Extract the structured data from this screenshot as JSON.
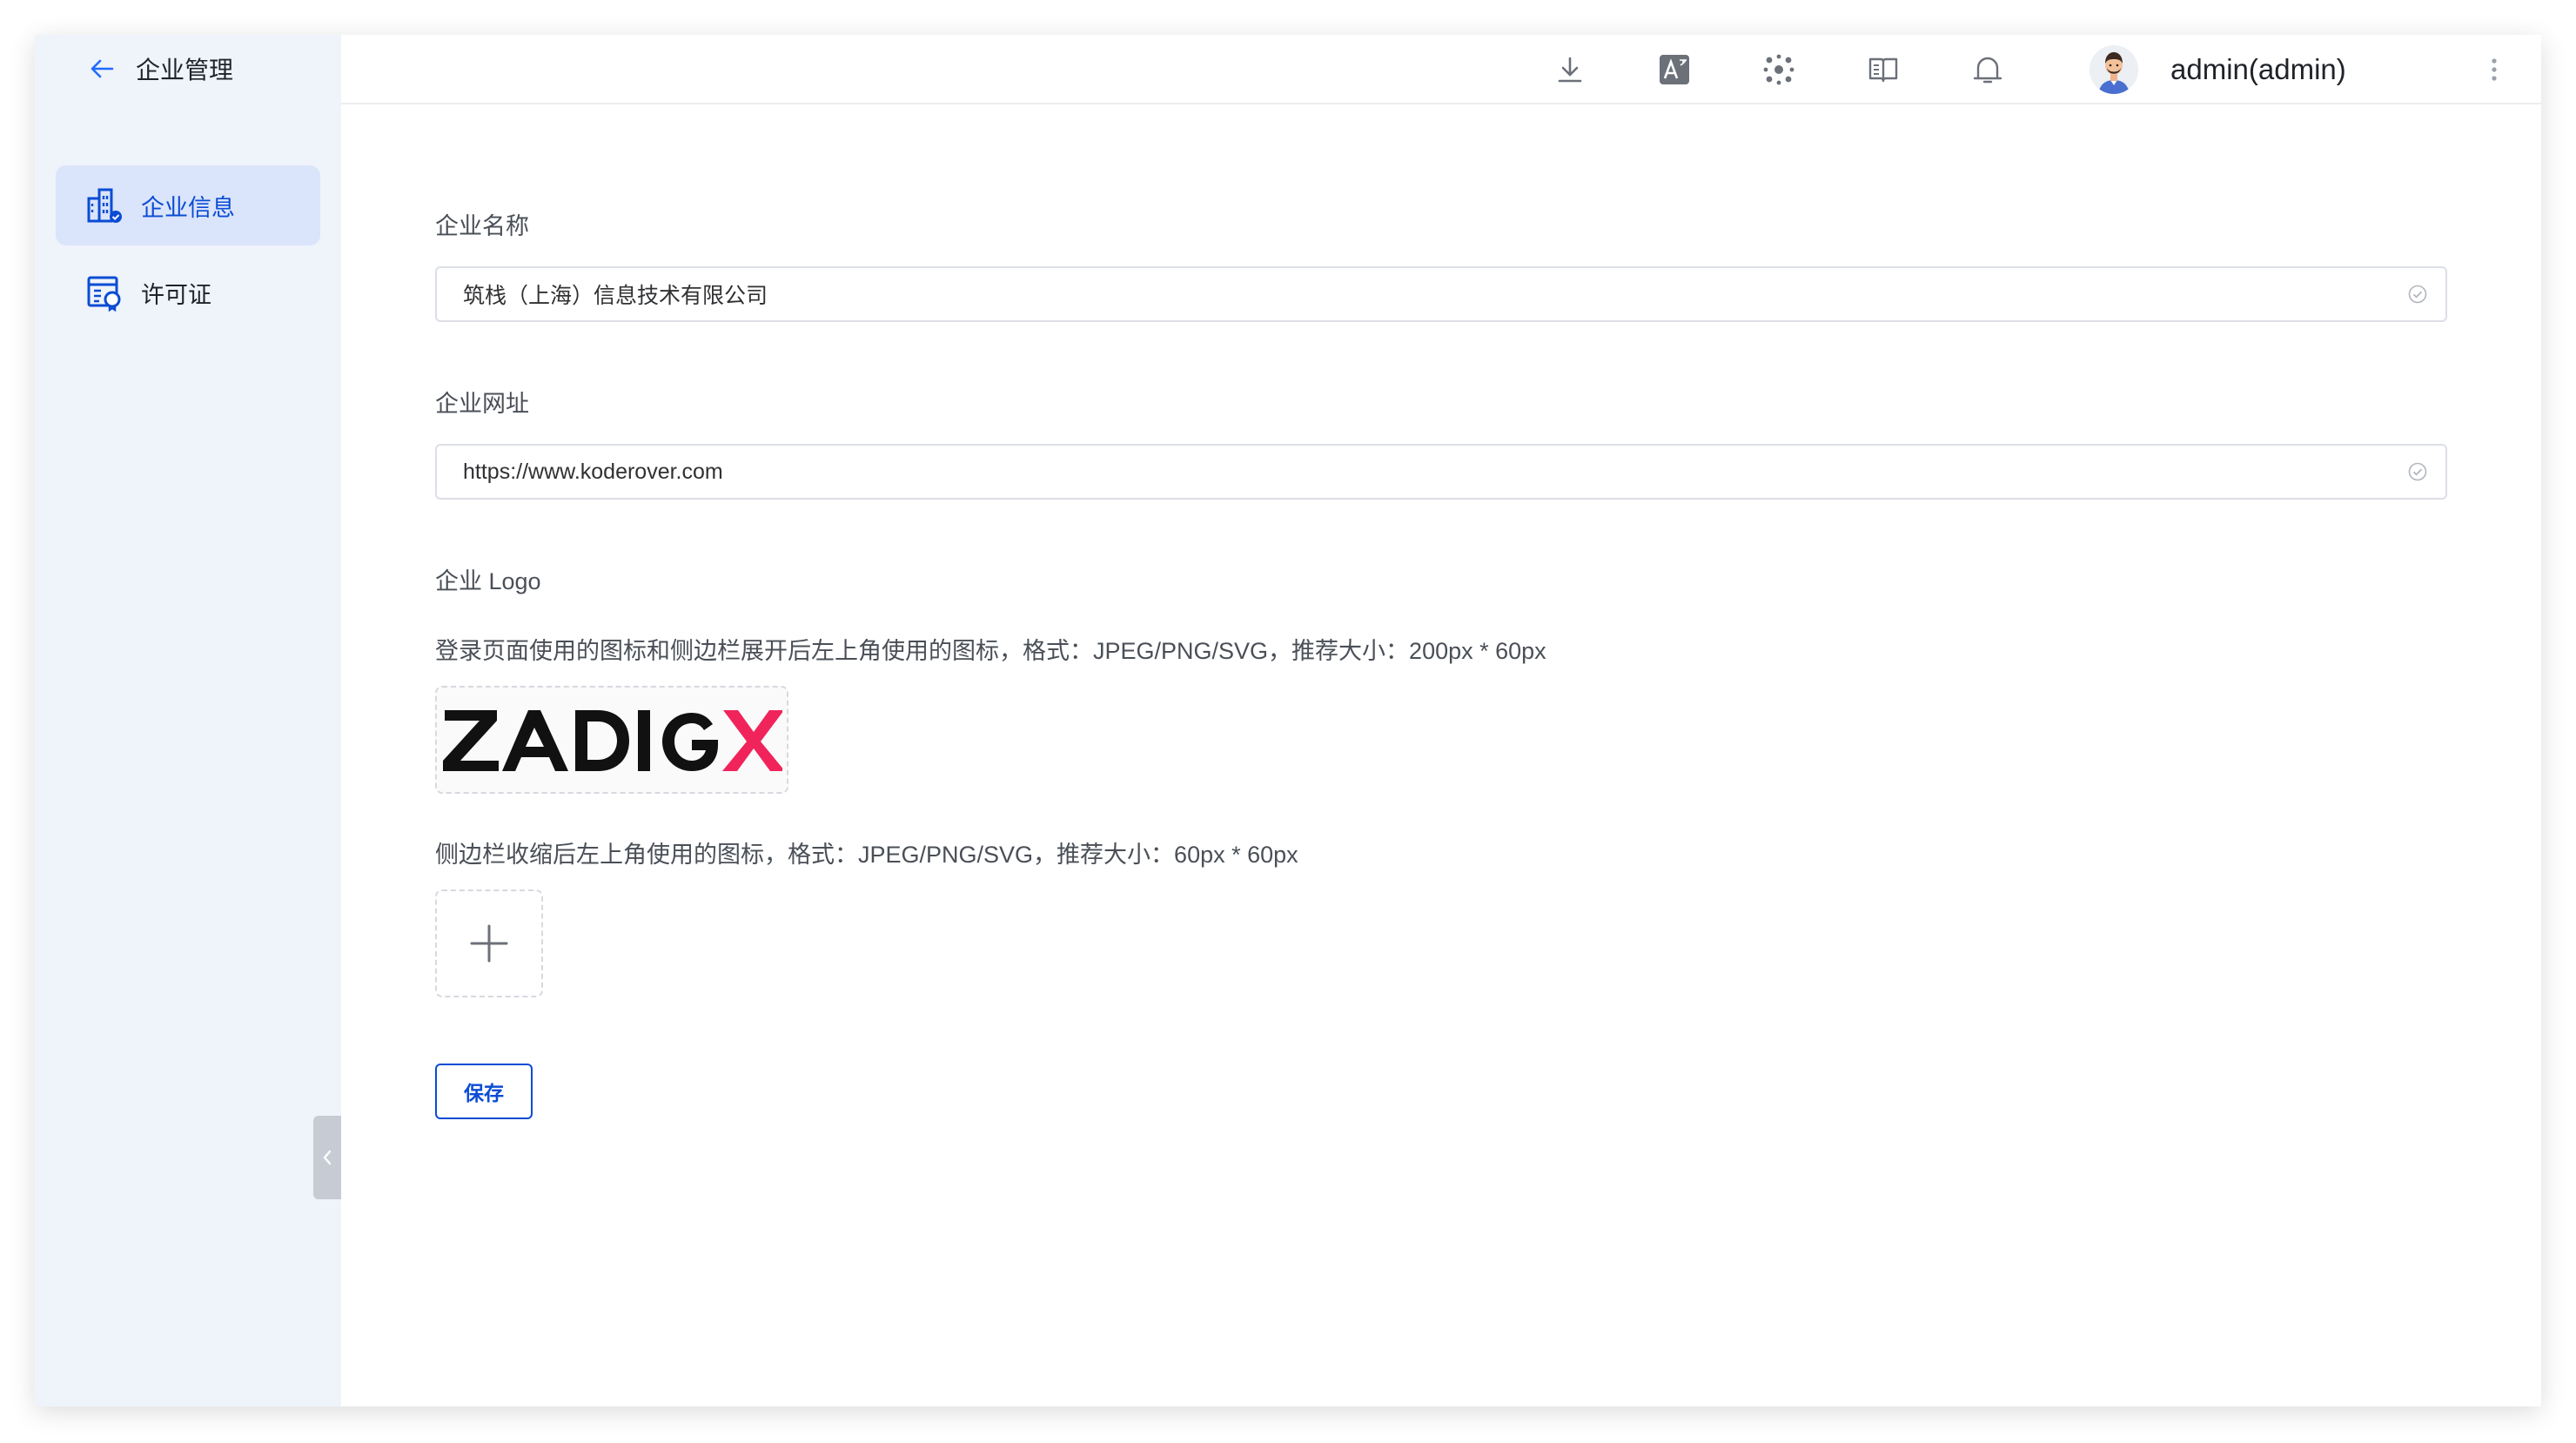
{
  "sidebar": {
    "title": "企业管理",
    "items": [
      {
        "label": "企业信息",
        "active": true
      },
      {
        "label": "许可证",
        "active": false
      }
    ]
  },
  "topbar": {
    "username": "admin(admin)",
    "icons": [
      "download-icon",
      "translate-icon",
      "plugin-icon",
      "docs-icon",
      "bell-icon",
      "more-vertical-icon"
    ]
  },
  "form": {
    "company_name": {
      "label": "企业名称",
      "value": "筑栈（上海）信息技术有限公司"
    },
    "company_url": {
      "label": "企业网址",
      "value": "https://www.koderover.com"
    },
    "logo": {
      "label": "企业 Logo",
      "hint_expanded": "登录页面使用的图标和侧边栏展开后左上角使用的图标，格式：JPEG/PNG/SVG，推荐大小：200px * 60px",
      "logo_text": "ZADIGX",
      "hint_collapsed": "侧边栏收缩后左上角使用的图标，格式：JPEG/PNG/SVG，推荐大小：60px * 60px"
    },
    "save_label": "保存"
  },
  "colors": {
    "accent": "#0b4cd4",
    "sidebar_bg": "#eff3fa",
    "sidebar_active_bg": "#dae4fa",
    "logo_red": "#f0245b"
  }
}
